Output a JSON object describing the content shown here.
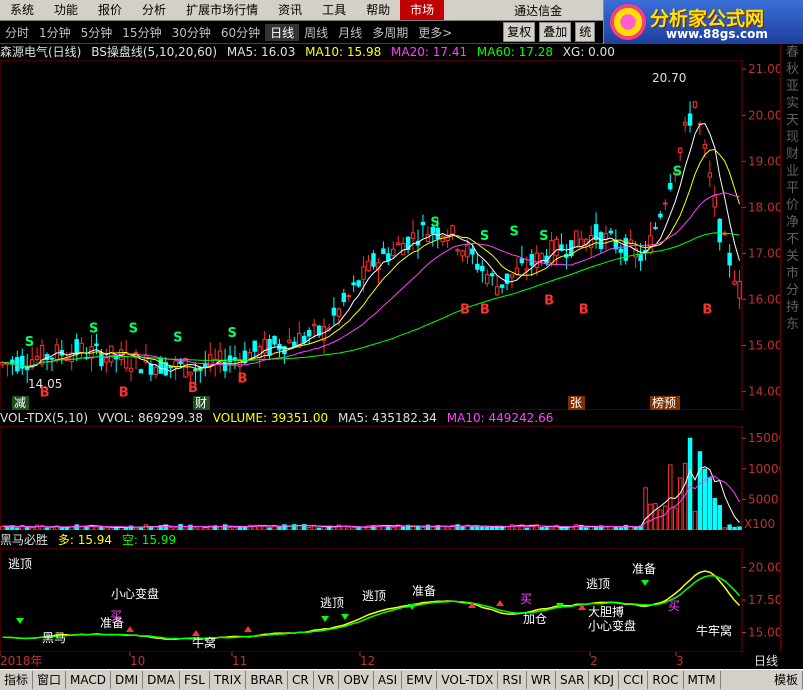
{
  "menu": {
    "items": [
      "系统",
      "功能",
      "报价",
      "分析",
      "扩展市场行情",
      "资讯",
      "工具",
      "帮助"
    ],
    "active": "市场",
    "broker": "通达信金"
  },
  "logo": {
    "title": "分析家公式网",
    "url": "www.88gs.com"
  },
  "periods": {
    "items": [
      "分时",
      "1分钟",
      "5分钟",
      "15分钟",
      "30分钟",
      "60分钟",
      "日线",
      "周线",
      "月线",
      "多周期",
      "更多>"
    ],
    "active_index": 6,
    "buttons": [
      "复权",
      "叠加",
      "统"
    ]
  },
  "main_info": {
    "stock": "森源电气(日线)",
    "indicator": "BS操盘线(5,10,20,60)",
    "ma5": "MA5: 16.03",
    "ma10": "MA10: 15.98",
    "ma20": "MA20: 17.41",
    "ma60": "MA60: 17.28",
    "xg": "XG: 0.00"
  },
  "vol_info": {
    "name": "VOL-TDX(5,10)",
    "vvol": "VVOL: 869299.38",
    "volume": "VOLUME: 39351.00",
    "ma5": "MA5: 435182.34",
    "ma10": "MA10: 449242.66"
  },
  "hm_info": {
    "name": "黑马必胜",
    "duo": "多: 15.94",
    "kong": "空: 15.99"
  },
  "price_axis": [
    "21.00",
    "20.00",
    "19.00",
    "18.00",
    "17.00",
    "16.00",
    "15.00",
    "14.00"
  ],
  "vol_axis": [
    "15000",
    "10000",
    "5000",
    "X100"
  ],
  "hm_axis": [
    "20.00",
    "17.50",
    "15.00"
  ],
  "x_axis": {
    "labels": [
      "2018年",
      "10",
      "11",
      "12",
      "2",
      "3"
    ],
    "right": "日线"
  },
  "price_markers": {
    "high": "20.70",
    "low": "14.05",
    "events": [
      "减",
      "财",
      "张",
      "榜预"
    ]
  },
  "signals": {
    "buy": "B",
    "sell": "S"
  },
  "hm_annotations": [
    "逃顶",
    "黑马",
    "准备",
    "买",
    "小心变盘",
    "牛窝",
    "逃顶",
    "逃顶",
    "准备",
    "买",
    "加仓",
    "大胆搏",
    "小心变盘",
    "逃顶",
    "准备",
    "买",
    "牛牢窝"
  ],
  "tabs": [
    "指标",
    "窗口",
    "MACD",
    "DMI",
    "DMA",
    "FSL",
    "TRIX",
    "BRAR",
    "CR",
    "VR",
    "OBV",
    "ASI",
    "EMV",
    "VOL-TDX",
    "RSI",
    "WR",
    "SAR",
    "KDJ",
    "CCI",
    "ROC",
    "MTM",
    "模板"
  ],
  "sidebar_text": "春秋亚实天现财业平价净不关市分持东",
  "colors": {
    "up": "#ff3030",
    "down": "#00ffff",
    "ma5": "#ffffff",
    "ma10": "#ffff00",
    "ma20": "#ff40ff",
    "ma60": "#00ff00",
    "axis": "#c03030"
  }
}
